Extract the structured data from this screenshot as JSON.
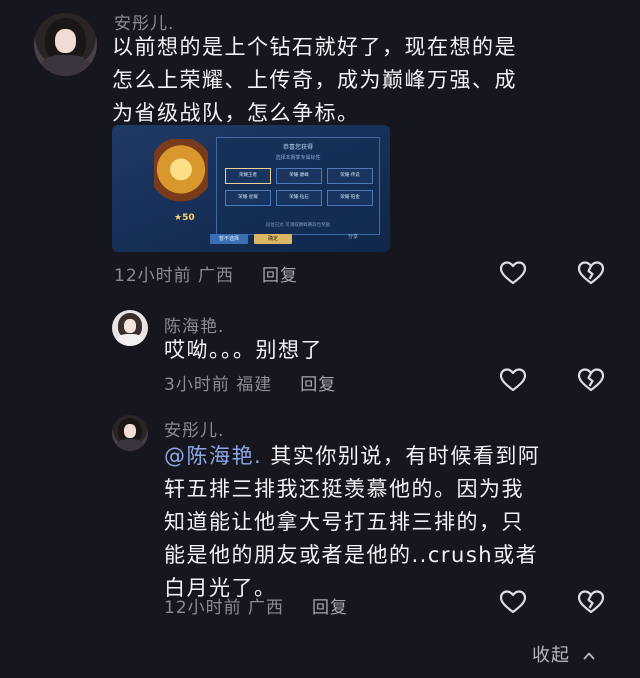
{
  "comments": [
    {
      "username": "安彤儿.",
      "text": "以前想的是上个钻石就好了，现在想的是怎么上荣耀、上传奇，成为巅峰万强、成为省级战队，怎么争标。",
      "text_lines": [
        "以前想的是上个钻石就好了，现在想的是",
        "怎么上荣耀、上传奇，成为巅峰万强、成",
        "为省级战队，怎么争标。"
      ],
      "meta_time_location": "12小时前 广西",
      "reply_label": "回复"
    },
    {
      "username": "陈海艳.",
      "text": "哎呦。。。别想了",
      "meta_time_location": "3小时前 福建",
      "reply_label": "回复"
    },
    {
      "username": "安彤儿.",
      "mention": "@陈海艳.",
      "text_lines_after_mention": [
        " 其实你别说，有时候看到阿",
        "轩五排三排我还挺羡慕他的。因为我",
        "知道能让他拿大号打五排三排的，只",
        "能是他的朋友或者是他的..crush或者",
        "白月光了。"
      ],
      "meta_time_location": "12小时前 广西",
      "reply_label": "回复"
    }
  ],
  "screenshot": {
    "panel_title": "恭喜您获得",
    "panel_subtitle": "选择本赛季专属标性",
    "badge_stars": "★50",
    "slots": [
      "荣耀王者",
      "荣耀·巅峰",
      "荣耀·传说",
      "荣耀·星耀",
      "荣耀·钻石",
      "荣耀·铂金"
    ],
    "panel_footer": "段位已达 可领取巅峰赛段位奖励",
    "btn_cancel": "暂不选择",
    "btn_ok": "确定",
    "share": "分享"
  },
  "icons": {
    "like": "heart-outline-icon",
    "dislike": "broken-heart-icon"
  },
  "footer": {
    "collapse_label": "收起"
  }
}
